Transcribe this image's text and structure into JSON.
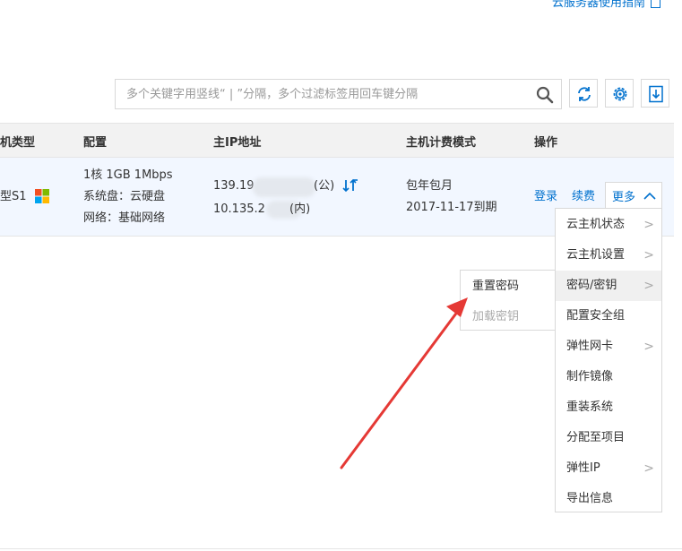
{
  "header": {
    "guide_link": "云服务器使用指南"
  },
  "search": {
    "placeholder": "多个关键字用竖线“ | ”分隔，多个过滤标签用回车键分隔",
    "value": ""
  },
  "toolbar": {
    "icons": [
      "refresh-icon",
      "gear-icon",
      "download-icon"
    ]
  },
  "table": {
    "headers": {
      "type": "机类型",
      "config": "配置",
      "ip": "主IP地址",
      "billing": "主机计费模式",
      "actions": "操作"
    },
    "row": {
      "type": "型S1",
      "config": [
        "1核 1GB 1Mbps",
        "系统盘：云硬盘",
        "网络：基础网络"
      ],
      "ip_public_prefix": "139.19",
      "ip_public_suffix": "(公)",
      "ip_private_prefix": "10.135.2",
      "ip_private_suffix": "(内)",
      "billing_mode": "包年包月",
      "expire": "2017-11-17到期",
      "actions": {
        "login": "登录",
        "renew": "续费",
        "more": "更多"
      }
    }
  },
  "more_menu": {
    "items": [
      {
        "label": "云主机状态",
        "has_sub": true
      },
      {
        "label": "云主机设置",
        "has_sub": true
      },
      {
        "label": "密码/密钥",
        "has_sub": true,
        "active": true
      },
      {
        "label": "配置安全组",
        "has_sub": false
      },
      {
        "label": "弹性网卡",
        "has_sub": true
      },
      {
        "label": "制作镜像",
        "has_sub": false
      },
      {
        "label": "重装系统",
        "has_sub": false
      },
      {
        "label": "分配至项目",
        "has_sub": false
      },
      {
        "label": "弹性IP",
        "has_sub": true
      },
      {
        "label": "导出信息",
        "has_sub": false
      }
    ]
  },
  "password_submenu": {
    "items": [
      {
        "label": "重置密码",
        "disabled": false
      },
      {
        "label": "加载密钥",
        "disabled": true
      }
    ]
  },
  "colors": {
    "accent": "#0071ce",
    "annotation_arrow": "#e53935",
    "row_highlight": "#f2f7ff"
  }
}
